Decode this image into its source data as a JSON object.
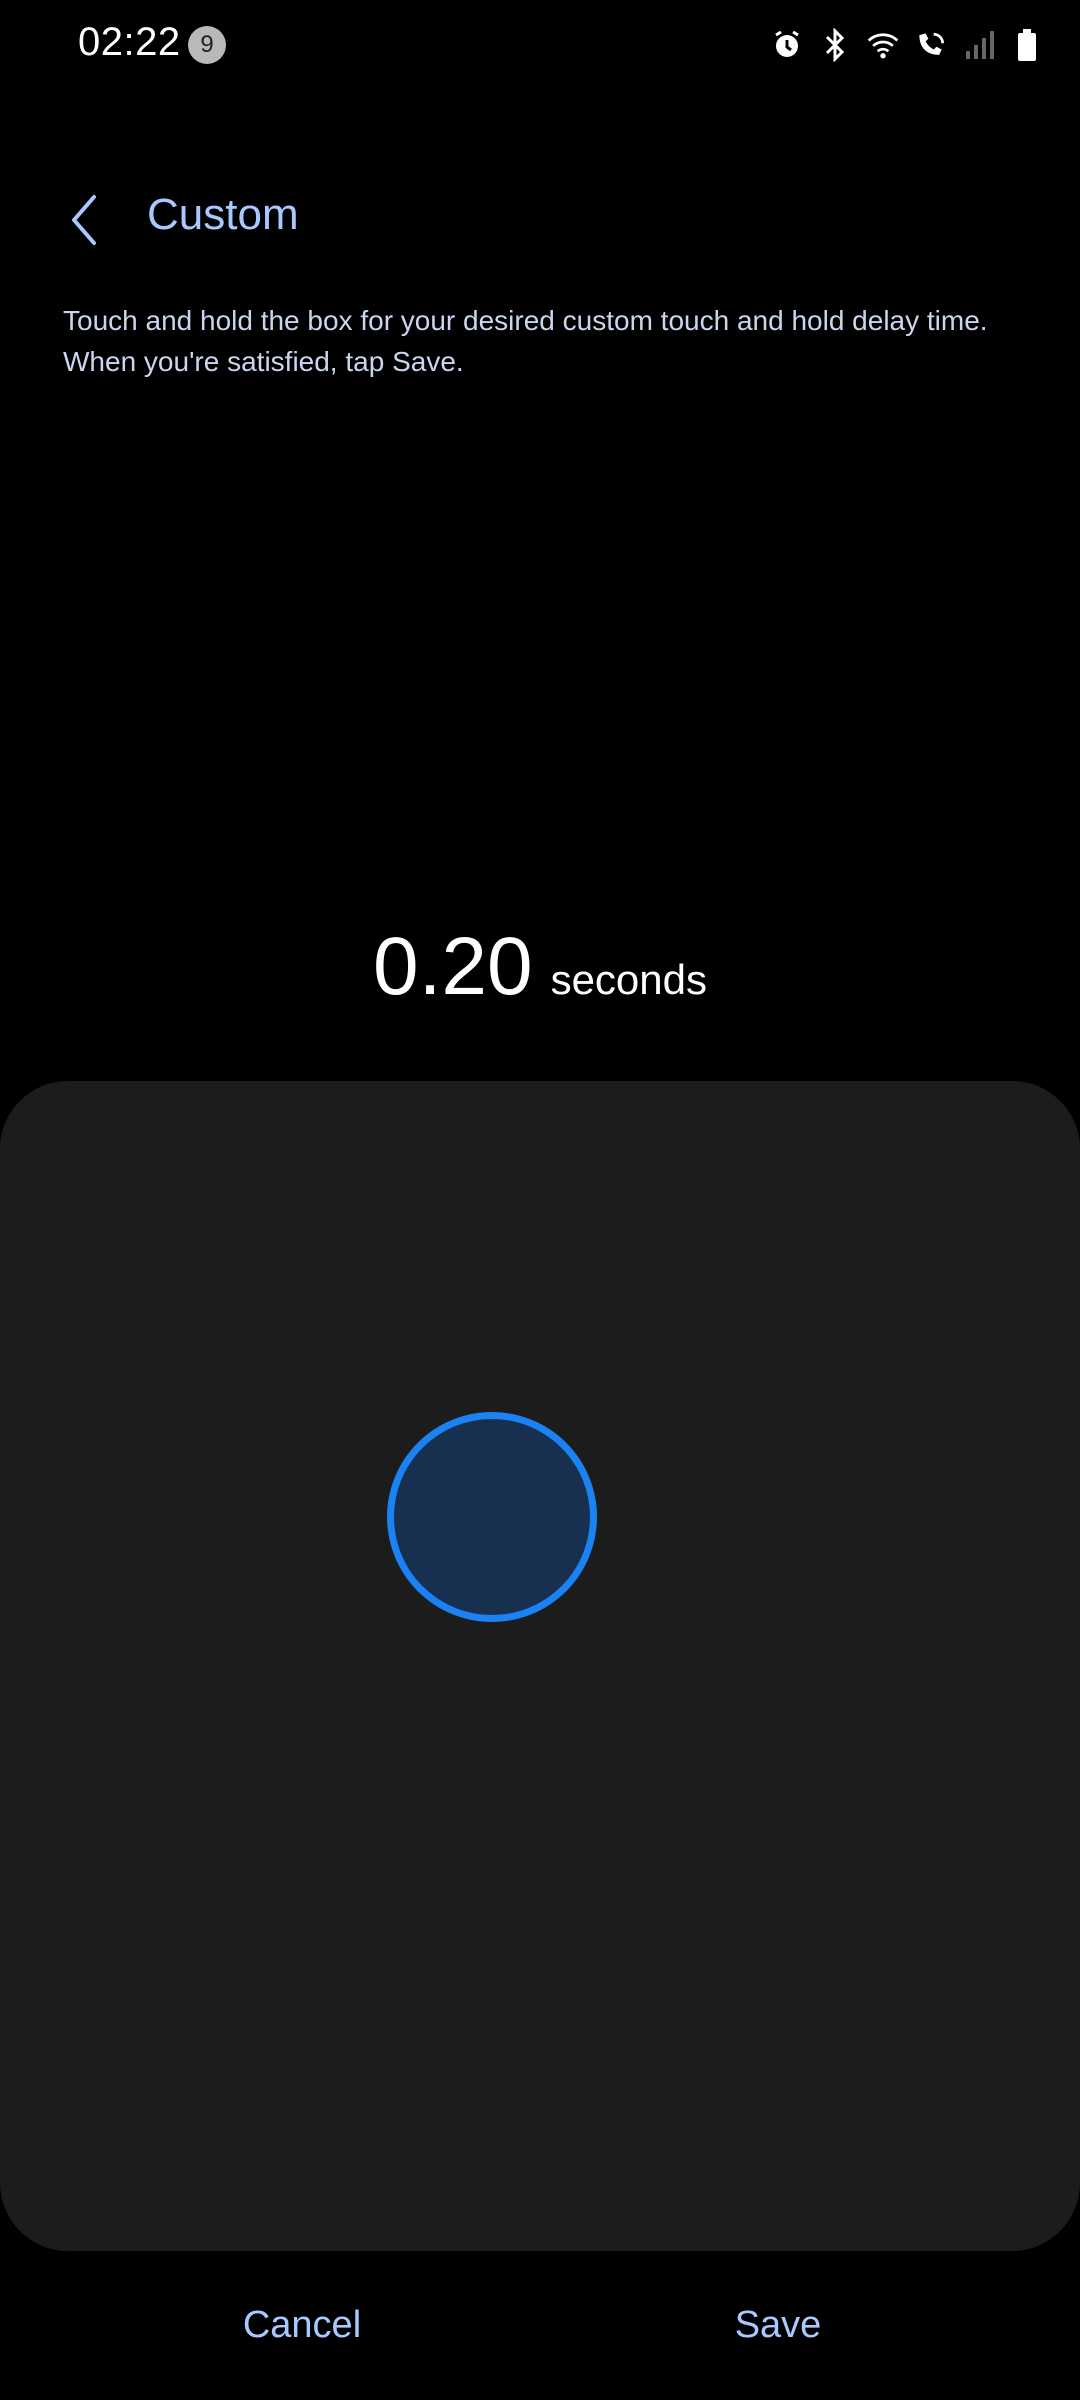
{
  "status_bar": {
    "time": "02:22",
    "notification_count": "9",
    "icons": [
      "alarm-icon",
      "bluetooth-icon",
      "wifi-icon",
      "wifi-call-icon",
      "signal-icon",
      "battery-icon"
    ]
  },
  "header": {
    "title": "Custom"
  },
  "description": "Touch and hold the box for your desired custom touch and hold delay time. When you're satisfied, tap Save.",
  "readout": {
    "value": "0.20",
    "unit": "seconds"
  },
  "buttons": {
    "cancel": "Cancel",
    "save": "Save"
  },
  "colors": {
    "accent": "#a9c8ff",
    "indicator_ring": "#1a82f2",
    "indicator_fill": "#17304f",
    "box_bg": "#1c1c1c"
  }
}
